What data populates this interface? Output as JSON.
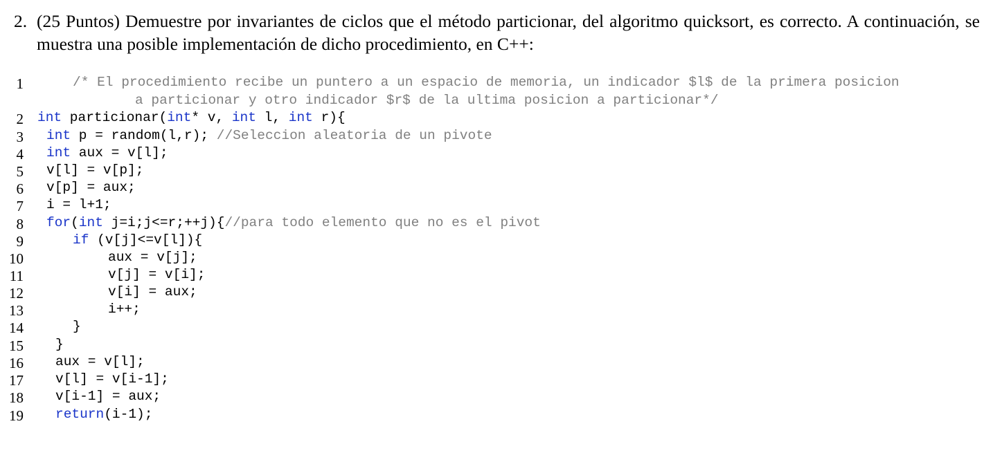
{
  "problem": {
    "number": "2.",
    "text": "(25 Puntos) Demuestre por invariantes de ciclos que el método particionar, del algoritmo quicksort, es correcto. A continuación, se muestra una posible implementación de dicho procedimiento, en C++:"
  },
  "code": {
    "colors": {
      "keyword": "#1a35c9",
      "comment": "#808080",
      "text": "#000000"
    },
    "lines": [
      {
        "n": "1",
        "tokens": [
          {
            "t": "/* El procedimiento recibe un puntero a un espacio de memoria, un indicador $l$ de la primera posicion",
            "c": "cm"
          }
        ]
      },
      {
        "n": "",
        "tokens": [
          {
            "t": "a particionar y otro indicador $r$ de la ultima posicion a particionar*/",
            "c": "cm"
          }
        ]
      },
      {
        "n": "2",
        "tokens": [
          {
            "t": "int",
            "c": "kw"
          },
          {
            "t": " particionar("
          },
          {
            "t": "int",
            "c": "kw"
          },
          {
            "t": "* v, "
          },
          {
            "t": "int",
            "c": "kw"
          },
          {
            "t": " l, "
          },
          {
            "t": "int",
            "c": "kw"
          },
          {
            "t": " r){"
          }
        ]
      },
      {
        "n": "3",
        "tokens": [
          {
            "t": "int",
            "c": "kw"
          },
          {
            "t": " p = random(l,r); "
          },
          {
            "t": "//Seleccion aleatoria de un pivote",
            "c": "cm"
          }
        ]
      },
      {
        "n": "4",
        "tokens": [
          {
            "t": "int",
            "c": "kw"
          },
          {
            "t": " aux = v[l];"
          }
        ]
      },
      {
        "n": "5",
        "tokens": [
          {
            "t": "v[l] = v[p];"
          }
        ]
      },
      {
        "n": "6",
        "tokens": [
          {
            "t": "v[p] = aux;"
          }
        ]
      },
      {
        "n": "7",
        "tokens": [
          {
            "t": "i = l+1;"
          }
        ]
      },
      {
        "n": "8",
        "tokens": [
          {
            "t": "for",
            "c": "kw"
          },
          {
            "t": "("
          },
          {
            "t": "int",
            "c": "kw"
          },
          {
            "t": " j=i;j<=r;++j){"
          },
          {
            "t": "//para todo elemento que no es el pivot",
            "c": "cm"
          }
        ]
      },
      {
        "n": "9",
        "tokens": [
          {
            "t": "if",
            "c": "kw"
          },
          {
            "t": " (v[j]<=v[l]){"
          }
        ]
      },
      {
        "n": "10",
        "tokens": [
          {
            "t": "aux = v[j];"
          }
        ]
      },
      {
        "n": "11",
        "tokens": [
          {
            "t": "v[j] = v[i];"
          }
        ]
      },
      {
        "n": "12",
        "tokens": [
          {
            "t": "v[i] = aux;"
          }
        ]
      },
      {
        "n": "13",
        "tokens": [
          {
            "t": "i++;"
          }
        ]
      },
      {
        "n": "14",
        "tokens": [
          {
            "t": "}"
          }
        ]
      },
      {
        "n": "15",
        "tokens": [
          {
            "t": "}"
          }
        ]
      },
      {
        "n": "16",
        "tokens": [
          {
            "t": "aux = v[l];"
          }
        ]
      },
      {
        "n": "17",
        "tokens": [
          {
            "t": "v[l] = v[i-1];"
          }
        ]
      },
      {
        "n": "18",
        "tokens": [
          {
            "t": "v[i-1] = aux;"
          }
        ]
      },
      {
        "n": "19",
        "tokens": [
          {
            "t": "return",
            "c": "kw"
          },
          {
            "t": "(i-1);"
          }
        ]
      }
    ]
  }
}
